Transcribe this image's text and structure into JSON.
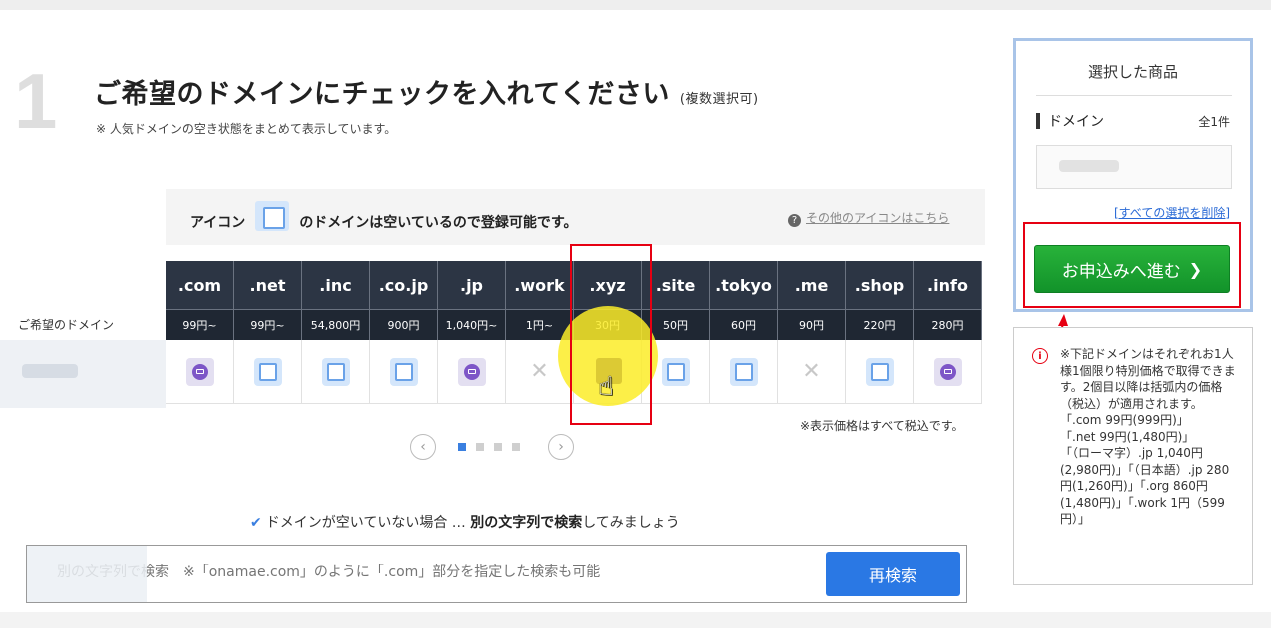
{
  "step": {
    "number": "1",
    "title": "ご希望のドメインにチェックを入れてください",
    "title_note": "(複数選択可)",
    "subtitle": "※ 人気ドメインの空き状態をまとめて表示しています。"
  },
  "legend": {
    "prefix": "アイコン",
    "suffix": "のドメインは空いているので登録可能です。",
    "link": "その他のアイコンはこちら"
  },
  "table": {
    "row_label": "ご希望のドメイン",
    "tlds": [
      ".com",
      ".net",
      ".inc",
      ".co.jp",
      ".jp",
      ".work",
      ".xyz",
      ".site",
      ".tokyo",
      ".me",
      ".shop",
      ".info"
    ],
    "prices": [
      "99円~",
      "99円~",
      "54,800円",
      "900円",
      "1,040円~",
      "1円~",
      "30円",
      "50円",
      "60円",
      "90円",
      "220円",
      "280円"
    ],
    "status": [
      "mail",
      "available",
      "available",
      "available",
      "mail",
      "unavailable",
      "selected",
      "available",
      "available",
      "unavailable",
      "available",
      "mail"
    ]
  },
  "tax_note": "※表示価格はすべて税込です。",
  "pager": {
    "prev": "‹",
    "next": "›",
    "pages": 4,
    "active": 1
  },
  "hint": {
    "prefix": "ドメインが空いていない場合 … ",
    "bold": "別の文字列で検索",
    "suffix": "してみましょう"
  },
  "search": {
    "placeholder": "別の文字列で検索　※「onamae.com」のように「.com」部分を指定した検索も可能",
    "button": "再検索"
  },
  "selected_panel": {
    "title": "選択した商品",
    "label": "ドメイン",
    "count": "全1件",
    "clear": "[すべての選択を削除]",
    "apply": "お申込みへ進む"
  },
  "notice": {
    "lines": [
      "※下記ドメインはそれぞれお1人様1個限り特別価格で取得できます。2個目以降は括弧内の価格（税込）が適用されます。",
      "「.com 99円(999円)」",
      "「.net 99円(1,480円)」",
      "「（ローマ字）.jp 1,040円(2,980円)」「（日本語）.jp 280円(1,260円)」「.org 860円(1,480円)」「.work 1円（599円）」"
    ]
  },
  "colors": {
    "accent_blue": "#2a78e4",
    "header_dark": "#2c3544",
    "apply_green": "#12932a",
    "annotation_red": "#e60012",
    "highlight_yellow": "#fcec28"
  }
}
